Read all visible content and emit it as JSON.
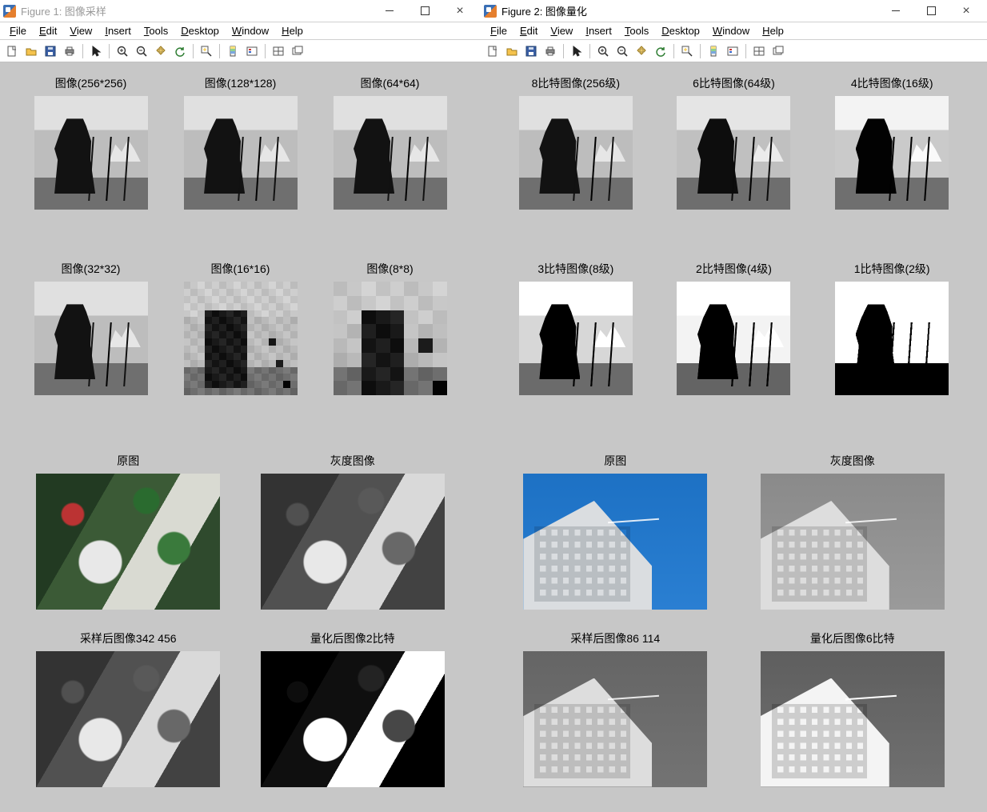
{
  "windows": {
    "fig1": {
      "title": "Figure 1: 图像采样",
      "active": false
    },
    "fig2": {
      "title": "Figure 2: 图像量化",
      "active": true
    }
  },
  "menus": [
    "File",
    "Edit",
    "View",
    "Insert",
    "Tools",
    "Desktop",
    "Window",
    "Help"
  ],
  "toolbarIcons": [
    "new",
    "open",
    "save",
    "print",
    "|",
    "pointer",
    "|",
    "zoom-in",
    "zoom-out",
    "pan",
    "rotate",
    "|",
    "data-cursor",
    "|",
    "colorbar",
    "legend",
    "|",
    "tile",
    "float"
  ],
  "fig1_subplots": [
    {
      "title": "图像(256*256)",
      "type": "cam"
    },
    {
      "title": "图像(128*128)",
      "type": "cam"
    },
    {
      "title": "图像(64*64)",
      "type": "cam"
    },
    {
      "title": "图像(32*32)",
      "type": "cam32"
    },
    {
      "title": "图像(16*16)",
      "type": "cam16"
    },
    {
      "title": "图像(8*8)",
      "type": "cam8"
    }
  ],
  "fig2_subplots": [
    {
      "title": "8比特图像(256级)",
      "type": "cam",
      "lv": ""
    },
    {
      "title": "6比特图像(64级)",
      "type": "cam",
      "lv": "lv64"
    },
    {
      "title": "4比特图像(16级)",
      "type": "cam",
      "lv": "lv16"
    },
    {
      "title": "3比特图像(8级)",
      "type": "cam",
      "lv": "lv8"
    },
    {
      "title": "2比特图像(4级)",
      "type": "cam",
      "lv": "lv4"
    },
    {
      "title": "1比特图像(2级)",
      "type": "cam",
      "lv": "lv2"
    }
  ],
  "bl_subplots": [
    {
      "title": "原图",
      "cls": "leaves"
    },
    {
      "title": "灰度图像",
      "cls": "leaves gray"
    },
    {
      "title": "采样后图像342  456",
      "cls": "leaves blocky"
    },
    {
      "title": "量化后图像2比特",
      "cls": "leaves post"
    }
  ],
  "br_subplots": [
    {
      "title": "原图",
      "cls": "building"
    },
    {
      "title": "灰度图像",
      "cls": "building gray"
    },
    {
      "title": "采样后图像86  114",
      "cls": "building blocky"
    },
    {
      "title": "量化后图像6比特",
      "cls": "building q6"
    }
  ]
}
